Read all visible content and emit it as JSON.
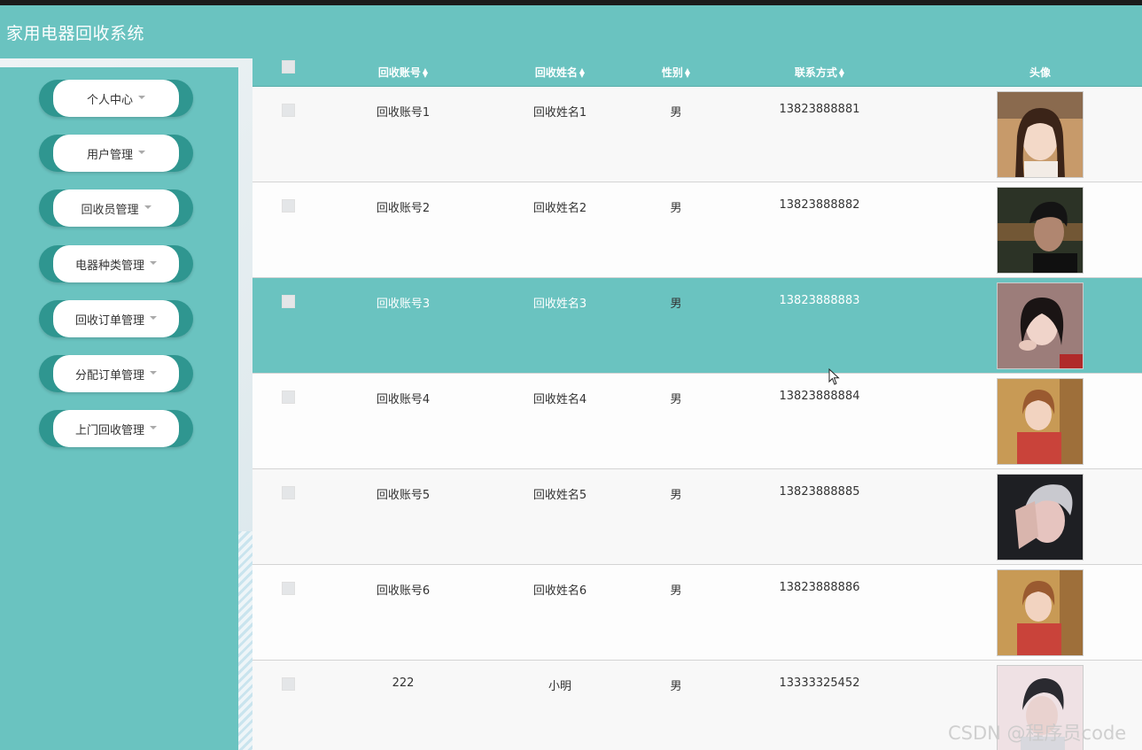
{
  "app": {
    "title": "家用电器回收系统"
  },
  "sidebar": {
    "items": [
      {
        "label": "个人中心"
      },
      {
        "label": "用户管理"
      },
      {
        "label": "回收员管理"
      },
      {
        "label": "电器种类管理"
      },
      {
        "label": "回收订单管理"
      },
      {
        "label": "分配订单管理"
      },
      {
        "label": "上门回收管理"
      }
    ]
  },
  "table": {
    "headers": {
      "account": "回收账号",
      "name": "回收姓名",
      "gender": "性别",
      "contact": "联系方式",
      "avatar": "头像"
    },
    "rows": [
      {
        "account": "回收账号1",
        "name": "回收姓名1",
        "gender": "男",
        "contact": "13823888881",
        "avatar": "portrait-woman-long-hair"
      },
      {
        "account": "回收账号2",
        "name": "回收姓名2",
        "gender": "男",
        "contact": "13823888882",
        "avatar": "portrait-man-dark-sunset"
      },
      {
        "account": "回收账号3",
        "name": "回收姓名3",
        "gender": "男",
        "contact": "13823888883",
        "avatar": "portrait-woman-bob-hair"
      },
      {
        "account": "回收账号4",
        "name": "回收姓名4",
        "gender": "男",
        "contact": "13823888884",
        "avatar": "portrait-woman-red-shirt"
      },
      {
        "account": "回收账号5",
        "name": "回收姓名5",
        "gender": "男",
        "contact": "13823888885",
        "avatar": "portrait-man-hand-face"
      },
      {
        "account": "回收账号6",
        "name": "回收姓名6",
        "gender": "男",
        "contact": "13823888886",
        "avatar": "portrait-woman-red-shirt"
      },
      {
        "account": "222",
        "name": "小明",
        "gender": "男",
        "contact": "13333325452",
        "avatar": "portrait-man-light"
      }
    ],
    "selected_row_index": 2
  },
  "watermark": {
    "text": "CSDN @程序员code"
  },
  "colors": {
    "accent": "#6ac3c0",
    "menu_button_dark": "#2f9690",
    "header_text": "#ffffff"
  }
}
